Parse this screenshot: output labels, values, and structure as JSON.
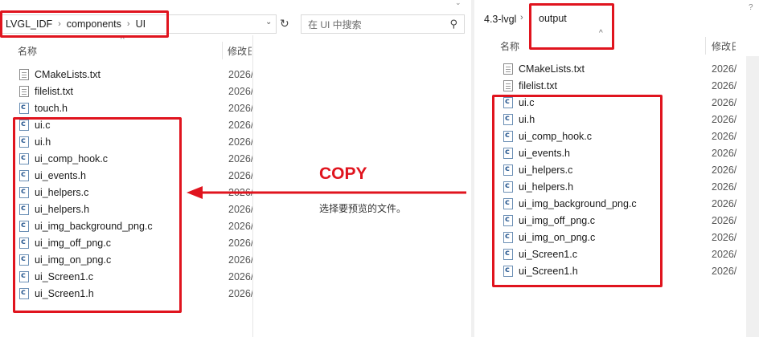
{
  "left_window": {
    "breadcrumbs": [
      "LVGL_IDF",
      "components",
      "UI"
    ],
    "search_placeholder": "在 UI 中搜索",
    "col_name": "名称",
    "col_modified": "修改日",
    "files": [
      {
        "name": "CMakeLists.txt",
        "type": "text",
        "date": "2026/"
      },
      {
        "name": "filelist.txt",
        "type": "text",
        "date": "2026/"
      },
      {
        "name": "touch.h",
        "type": "code",
        "date": "2026/"
      },
      {
        "name": "ui.c",
        "type": "code",
        "date": "2026/"
      },
      {
        "name": "ui.h",
        "type": "code",
        "date": "2026/"
      },
      {
        "name": "ui_comp_hook.c",
        "type": "code",
        "date": "2026/"
      },
      {
        "name": "ui_events.h",
        "type": "code",
        "date": "2026/"
      },
      {
        "name": "ui_helpers.c",
        "type": "code",
        "date": "2026/"
      },
      {
        "name": "ui_helpers.h",
        "type": "code",
        "date": "2026/"
      },
      {
        "name": "ui_img_background_png.c",
        "type": "code",
        "date": "2026/"
      },
      {
        "name": "ui_img_off_png.c",
        "type": "code",
        "date": "2026/"
      },
      {
        "name": "ui_img_on_png.c",
        "type": "code",
        "date": "2026/"
      },
      {
        "name": "ui_Screen1.c",
        "type": "code",
        "date": "2026/"
      },
      {
        "name": "ui_Screen1.h",
        "type": "code",
        "date": "2026/"
      }
    ],
    "preview_text": "选择要预览的文件。"
  },
  "annotation": {
    "copy_label": "COPY",
    "color": "#e0141e"
  },
  "right_window": {
    "breadcrumbs": [
      "4.3-lvgl",
      "output"
    ],
    "col_name": "名称",
    "col_modified": "修改日",
    "files": [
      {
        "name": "CMakeLists.txt",
        "type": "text",
        "date": "2026/"
      },
      {
        "name": "filelist.txt",
        "type": "text",
        "date": "2026/"
      },
      {
        "name": "ui.c",
        "type": "code",
        "date": "2026/"
      },
      {
        "name": "ui.h",
        "type": "code",
        "date": "2026/"
      },
      {
        "name": "ui_comp_hook.c",
        "type": "code",
        "date": "2026/"
      },
      {
        "name": "ui_events.h",
        "type": "code",
        "date": "2026/"
      },
      {
        "name": "ui_helpers.c",
        "type": "code",
        "date": "2026/"
      },
      {
        "name": "ui_helpers.h",
        "type": "code",
        "date": "2026/"
      },
      {
        "name": "ui_img_background_png.c",
        "type": "code",
        "date": "2026/"
      },
      {
        "name": "ui_img_off_png.c",
        "type": "code",
        "date": "2026/"
      },
      {
        "name": "ui_img_on_png.c",
        "type": "code",
        "date": "2026/"
      },
      {
        "name": "ui_Screen1.c",
        "type": "code",
        "date": "2026/"
      },
      {
        "name": "ui_Screen1.h",
        "type": "code",
        "date": "2026/"
      }
    ]
  }
}
